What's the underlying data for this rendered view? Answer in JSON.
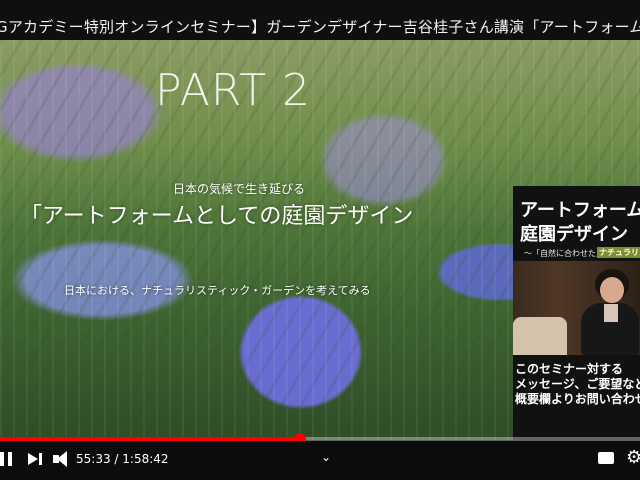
{
  "header": {
    "title": "Gアカデミー特別オンラインセミナー】ガーデンデザイナー吉谷桂子さん講演「アートフォームとしての"
  },
  "video": {
    "part_label": "PART 2",
    "caption_line1": "日本の気候で生き延びる",
    "caption_line2": "「アートフォームとしての庭園デザイン",
    "caption_line3": "日本における、ナチュラリスティック・ガーデンを考えてみる"
  },
  "side_panel": {
    "title_line1": "アートフォームと",
    "title_line2": "庭園デザイン",
    "subtitle": "～「自然に合わせた」",
    "subtitle_tag": "ナチュラリスティ",
    "message": [
      "このセミナー対する",
      "メッセージ、ご要望などは",
      "概要欄よりお問い合わせ"
    ]
  },
  "player": {
    "current_time": "55:33",
    "separator": "/",
    "duration": "1:58:42",
    "progress_fraction": 0.468,
    "progress_color": "#ff0000",
    "icons": {
      "play_pause": "pause-icon",
      "next": "next-icon",
      "volume": "volume-icon",
      "chapter": "chevron-down-icon",
      "subtitles": "subtitles-icon",
      "settings": "gear-icon"
    },
    "chevron_glyph": "⌄",
    "settings_glyph": "⚙"
  }
}
